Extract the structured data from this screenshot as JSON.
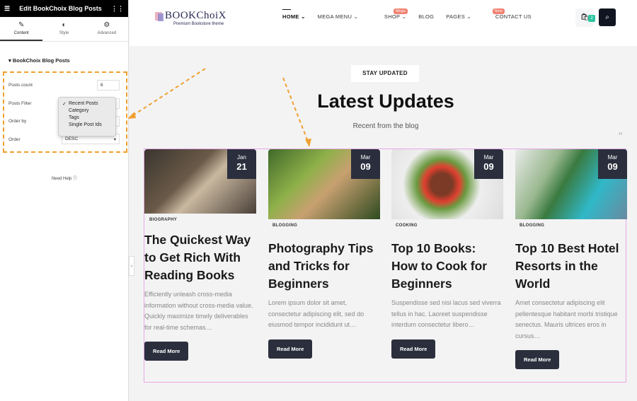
{
  "editor": {
    "title": "Edit BookChoix Blog Posts",
    "tabs": [
      {
        "label": "Content",
        "icon": "pencil-icon"
      },
      {
        "label": "Style",
        "icon": "contrast-icon"
      },
      {
        "label": "Advanced",
        "icon": "gear-icon"
      }
    ],
    "section": "BookChoix Blog Posts",
    "posts_count_label": "Posts count",
    "posts_count": "6",
    "posts_filter_label": "Posts Filter",
    "order_by_label": "Order by",
    "order_label": "Order",
    "order_value": "DESC",
    "filter_options": [
      "Recent Posts",
      "Category",
      "Tags",
      "Single Post Ids"
    ],
    "filter_selected": "Recent Posts",
    "check": "✓",
    "help": "Need Help"
  },
  "header": {
    "logo": "BOOKChoiX",
    "tagline": "Premium Bookstore theme",
    "nav": [
      "HOME",
      "MEGA MENU",
      "SHOP",
      "BLOG",
      "PAGES",
      "CONTACT US"
    ],
    "badges": {
      "mega": "Mega",
      "pages": "New"
    },
    "cart_count": "2"
  },
  "section": {
    "eyebrow": "STAY UPDATED",
    "title": "Latest Updates",
    "subtitle": "Recent from the blog"
  },
  "posts": [
    {
      "month": "Jan",
      "day": "21",
      "category": "BIOGRAPHY",
      "title": "The Quickest Way to Get Rich With Reading Books",
      "excerpt": "Efficiently unleash cross-media information without cross-media value. Quickly maximize timely deliverables for real-time schemas…",
      "button": "Read More"
    },
    {
      "month": "Mar",
      "day": "09",
      "category": "BLOGGING",
      "title": "Photography Tips and Tricks for Beginners",
      "excerpt": "Lorem ipsum dolor sit amet, consectetur adipiscing elit, sed do eiusmod tempor incididunt ut…",
      "button": "Read More"
    },
    {
      "month": "Mar",
      "day": "09",
      "category": "COOKING",
      "title": "Top 10 Books: How to Cook for Beginners",
      "excerpt": "Suspendisse sed nisi lacus sed viverra tellus in hac. Laoreet suspendisse interdum consectetur libero…",
      "button": "Read More"
    },
    {
      "month": "Mar",
      "day": "09",
      "category": "BLOGGING",
      "title": "Top 10 Best Hotel Resorts in the World",
      "excerpt": "Amet consectetur adipiscing elit pellentesque habitant morbi tristique senectus. Mauris ultrices eros in cursus…",
      "button": "Read More"
    }
  ]
}
